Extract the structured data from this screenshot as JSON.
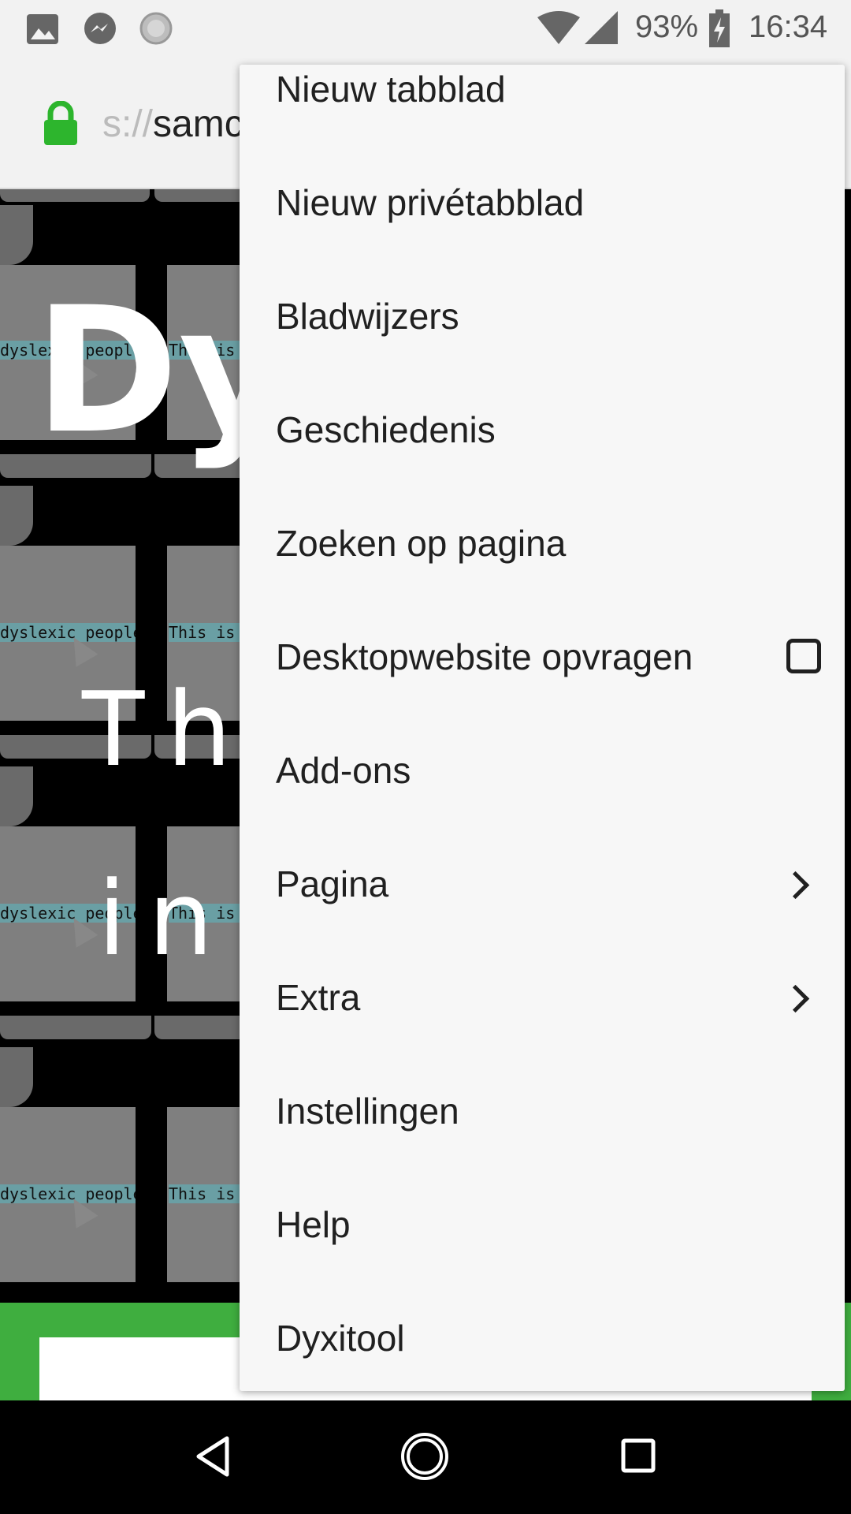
{
  "status_bar": {
    "battery": "93%",
    "time": "16:34",
    "icons": [
      "image-icon",
      "messenger-icon",
      "sync-icon",
      "wifi-icon",
      "signal-icon",
      "battery-charging-icon"
    ]
  },
  "url_bar": {
    "url_prefix": "s://",
    "url_visible": "samc",
    "lock_icon": "lock-icon",
    "lock_color": "#2db52d"
  },
  "page": {
    "hero_text": "Dy",
    "sub_line1": "Tha",
    "sub_line2": "ins",
    "tile_label_left": "dyslexic people",
    "tile_label_right": "This is a",
    "accent_green": "#3fae3f"
  },
  "menu": {
    "items": [
      {
        "label": "Nieuw tabblad"
      },
      {
        "label": "Nieuw privétabblad"
      },
      {
        "label": "Bladwijzers"
      },
      {
        "label": "Geschiedenis"
      },
      {
        "label": "Zoeken op pagina"
      },
      {
        "label": "Desktopwebsite opvragen",
        "checked": false
      },
      {
        "label": "Add-ons"
      },
      {
        "label": "Pagina",
        "submenu": true
      },
      {
        "label": "Extra",
        "submenu": true
      },
      {
        "label": "Instellingen"
      },
      {
        "label": "Help"
      },
      {
        "label": "Dyxitool"
      }
    ]
  },
  "nav_bar": {
    "icons": [
      "back-icon",
      "home-icon",
      "recents-icon"
    ]
  }
}
